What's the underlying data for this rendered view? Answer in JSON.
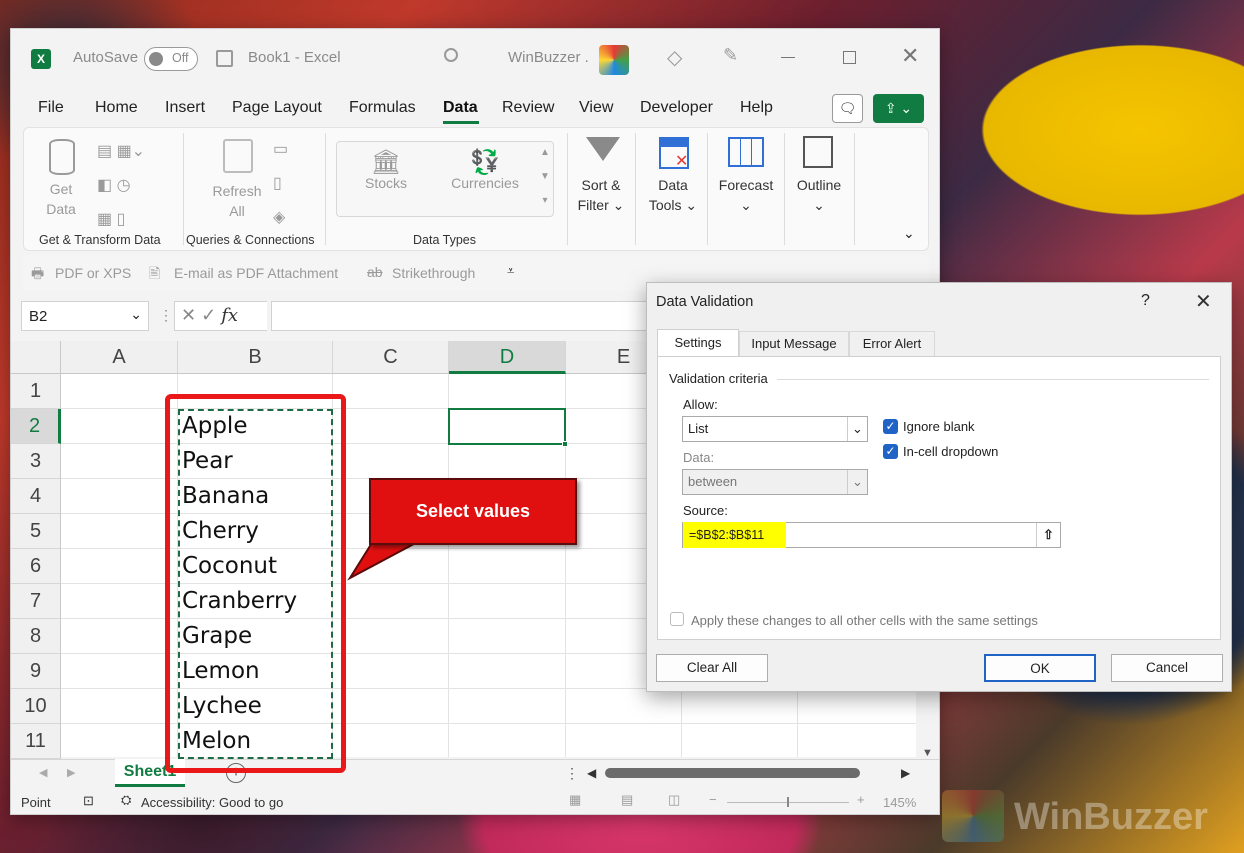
{
  "window": {
    "autosave_label": "AutoSave",
    "autosave_state": "Off",
    "doc_title": "Book1 - Excel",
    "user": "WinBuzzer ."
  },
  "menu": [
    "File",
    "Home",
    "Insert",
    "Page Layout",
    "Formulas",
    "Data",
    "Review",
    "View",
    "Developer",
    "Help"
  ],
  "ribbon": {
    "get_data": "Get",
    "get_data2": "Data",
    "refresh": "Refresh",
    "refresh2": "All",
    "stocks": "Stocks",
    "currencies": "Currencies",
    "sort": "Sort &",
    "sort2": "Filter",
    "data_tools": "Data",
    "data_tools2": "Tools",
    "forecast": "Forecast",
    "outline": "Outline",
    "groups": [
      "Get & Transform Data",
      "Queries & Connections",
      "Data Types"
    ],
    "qat": [
      "PDF or XPS",
      "E-mail as PDF Attachment",
      "Strikethrough"
    ]
  },
  "namebox": "B2",
  "fx": "fx",
  "columns": [
    "A",
    "B",
    "C",
    "D",
    "E"
  ],
  "rows": [
    "1",
    "2",
    "3",
    "4",
    "5",
    "6",
    "7",
    "8",
    "9",
    "10",
    "11"
  ],
  "cells_b": [
    "Apple",
    "Pear",
    "Banana",
    "Cherry",
    "Coconut",
    "Cranberry",
    "Grape",
    "Lemon",
    "Lychee",
    "Melon"
  ],
  "callout": "Select values",
  "sheet_tab": "Sheet1",
  "status": {
    "mode": "Point",
    "accessibility": "Accessibility: Good to go",
    "zoom": "145%"
  },
  "dialog": {
    "title": "Data Validation",
    "help": "?",
    "tabs": [
      "Settings",
      "Input Message",
      "Error Alert"
    ],
    "criteria_label": "Validation criteria",
    "allow_label": "Allow:",
    "allow_value": "List",
    "data_label": "Data:",
    "data_value": "between",
    "ignore_blank": "Ignore blank",
    "in_cell": "In-cell dropdown",
    "source_label": "Source:",
    "source_value": "=$B$2:$B$11",
    "apply_all": "Apply these changes to all other cells with the same settings",
    "clear_all": "Clear All",
    "ok": "OK",
    "cancel": "Cancel"
  },
  "watermark": "WinBuzzer"
}
